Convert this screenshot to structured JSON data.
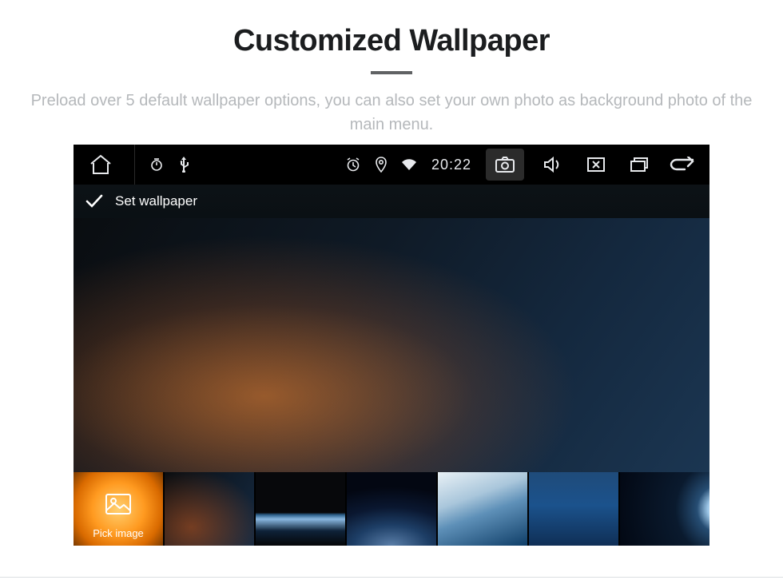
{
  "heading": {
    "title": "Customized Wallpaper",
    "subtitle": "Preload over 5 default wallpaper options, you can also set your own photo as background photo of the main menu."
  },
  "status_bar": {
    "clock": "20:22"
  },
  "set_row": {
    "label": "Set wallpaper"
  },
  "thumbs": {
    "pick_label": "Pick image"
  }
}
